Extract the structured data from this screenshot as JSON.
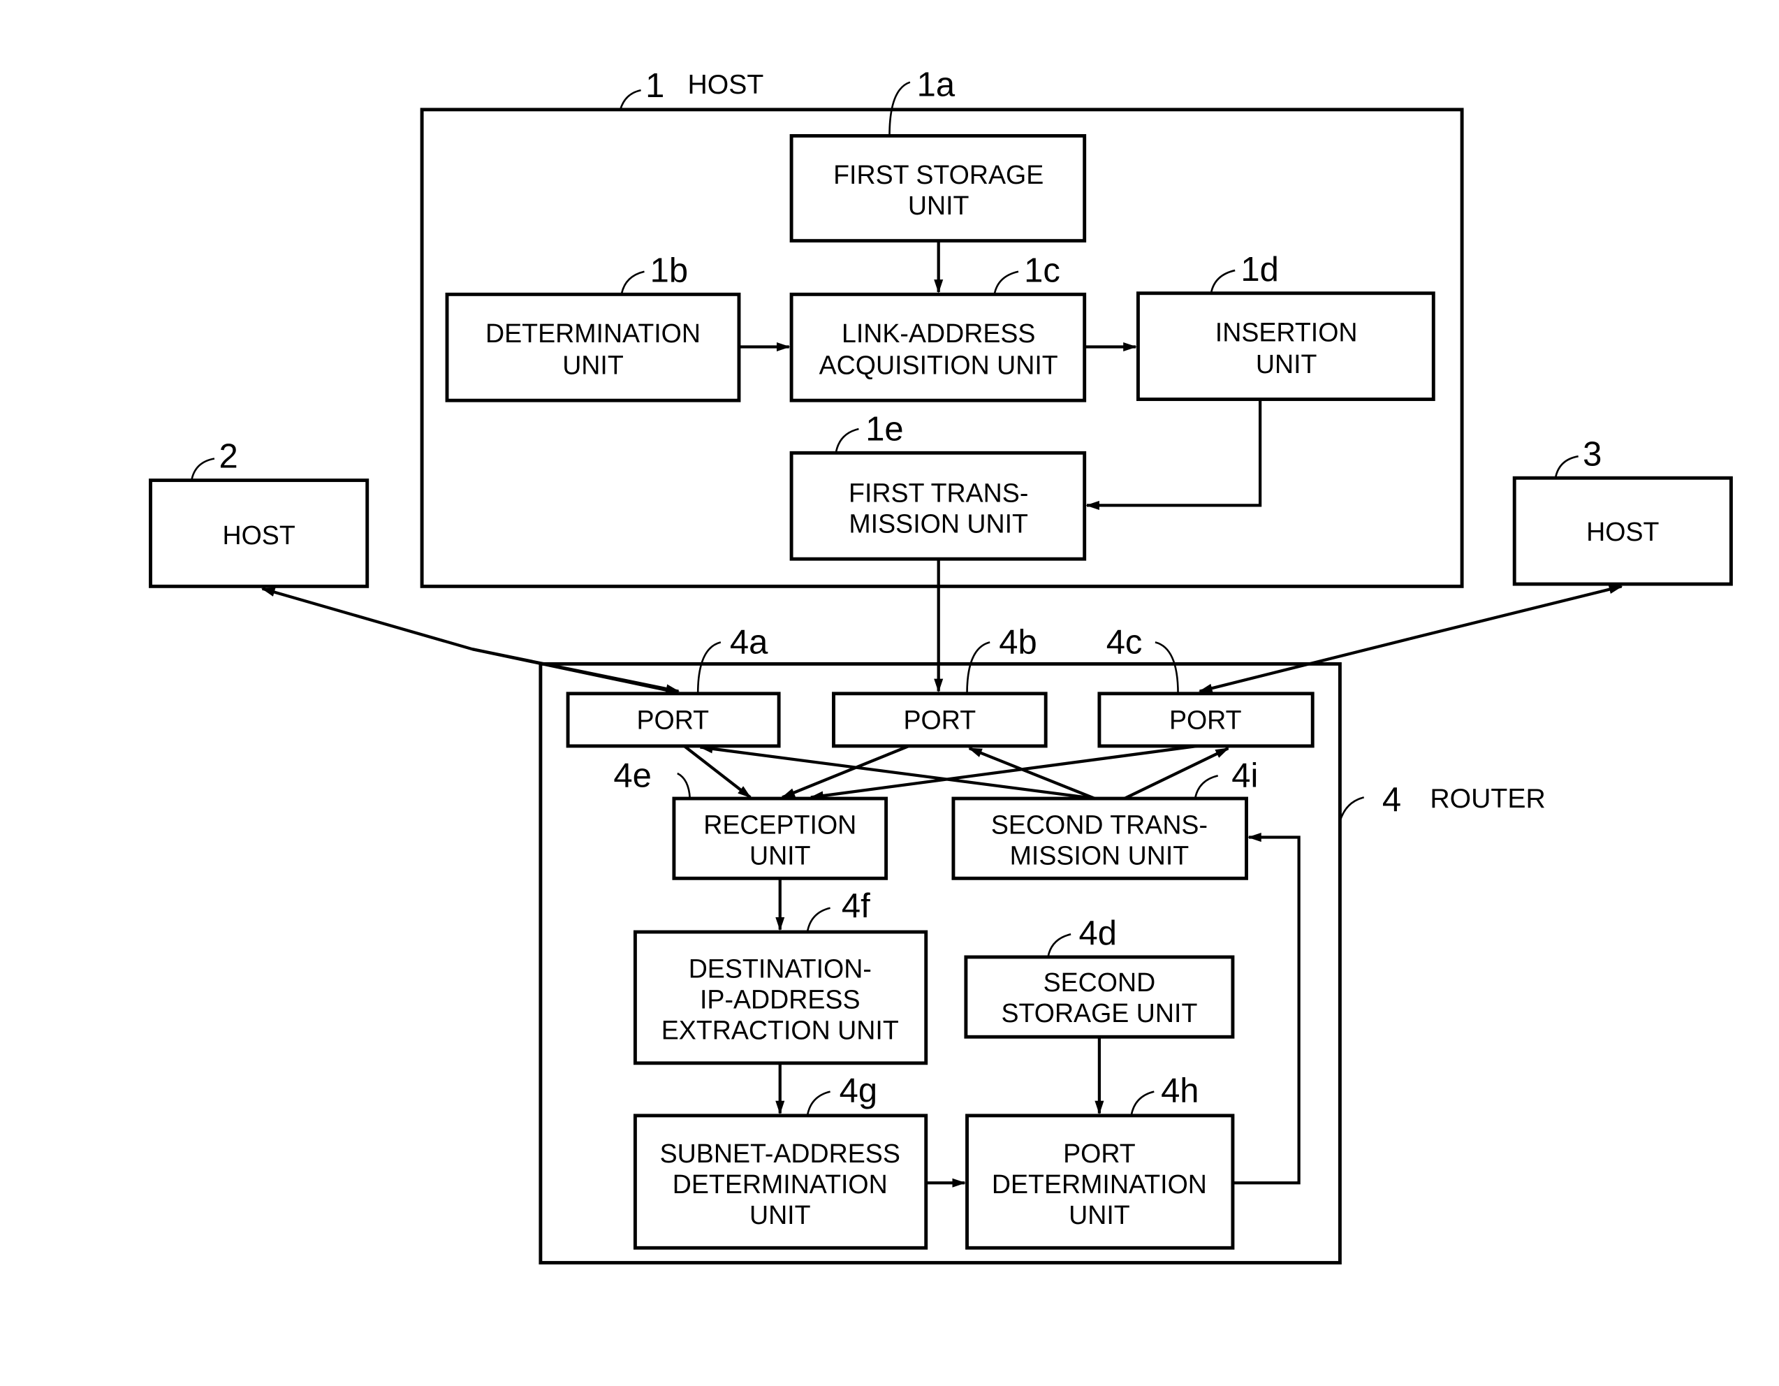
{
  "host1": {
    "ref": "1",
    "label": "HOST",
    "units": {
      "first_storage": {
        "ref": "1a",
        "lines": [
          "FIRST STORAGE",
          "UNIT"
        ]
      },
      "determination": {
        "ref": "1b",
        "lines": [
          "DETERMINATION",
          "UNIT"
        ]
      },
      "link_address": {
        "ref": "1c",
        "lines": [
          "LINK-ADDRESS",
          "ACQUISITION UNIT"
        ]
      },
      "insertion": {
        "ref": "1d",
        "lines": [
          "INSERTION",
          "UNIT"
        ]
      },
      "first_transmission": {
        "ref": "1e",
        "lines": [
          "FIRST TRANS-",
          "MISSION UNIT"
        ]
      }
    }
  },
  "host2": {
    "ref": "2",
    "label": "HOST"
  },
  "host3": {
    "ref": "3",
    "label": "HOST"
  },
  "router": {
    "ref": "4",
    "label": "ROUTER",
    "ports": [
      {
        "ref": "4a",
        "label": "PORT"
      },
      {
        "ref": "4b",
        "label": "PORT"
      },
      {
        "ref": "4c",
        "label": "PORT"
      }
    ],
    "units": {
      "reception": {
        "ref": "4e",
        "lines": [
          "RECEPTION",
          "UNIT"
        ]
      },
      "second_transmission": {
        "ref": "4i",
        "lines": [
          "SECOND TRANS-",
          "MISSION UNIT"
        ]
      },
      "dest_ip_extraction": {
        "ref": "4f",
        "lines": [
          "DESTINATION-",
          "IP-ADDRESS",
          "EXTRACTION UNIT"
        ]
      },
      "second_storage": {
        "ref": "4d",
        "lines": [
          "SECOND",
          "STORAGE UNIT"
        ]
      },
      "subnet_determination": {
        "ref": "4g",
        "lines": [
          "SUBNET-ADDRESS",
          "DETERMINATION",
          "UNIT"
        ]
      },
      "port_determination": {
        "ref": "4h",
        "lines": [
          "PORT",
          "DETERMINATION",
          "UNIT"
        ]
      }
    }
  }
}
